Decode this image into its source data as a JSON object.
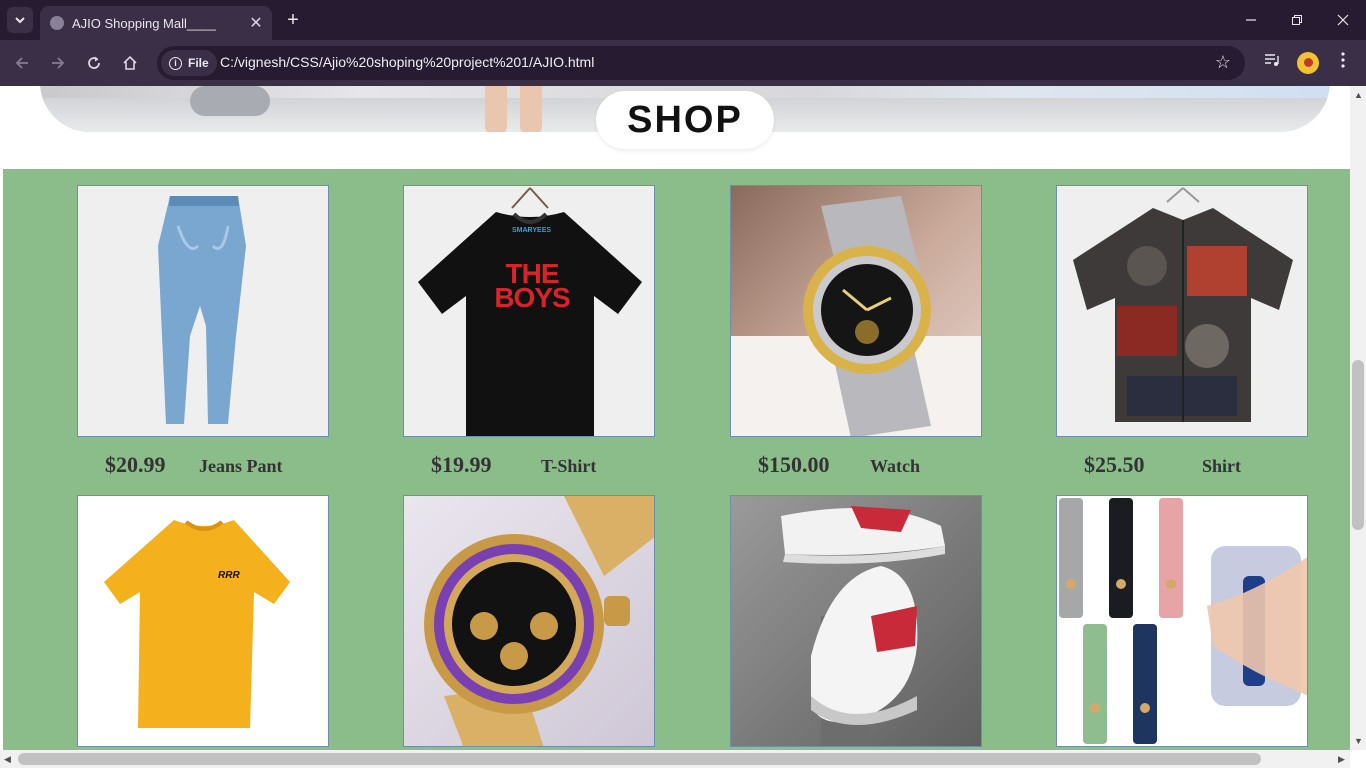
{
  "browser": {
    "tab_title": "AJIO Shopping Mall____",
    "address_chip": "File",
    "url": "C:/vignesh/CSS/Ajio%20shoping%20project%201/AJIO.html"
  },
  "banner": {
    "button_label": "SHOP"
  },
  "products": [
    {
      "price": "$20.99",
      "name": "Jeans Pant",
      "image": "jeans-image"
    },
    {
      "price": "$19.99",
      "name": "T-Shirt",
      "image": "black-tshirt-image"
    },
    {
      "price": "$150.00",
      "name": "Watch",
      "image": "watch-image"
    },
    {
      "price": "$25.50",
      "name": "Shirt",
      "image": "shirt-image"
    },
    {
      "price": "",
      "name": "",
      "image": "yellow-tshirt-image"
    },
    {
      "price": "",
      "name": "",
      "image": "gold-watch-image"
    },
    {
      "price": "",
      "name": "",
      "image": "sneakers-image"
    },
    {
      "price": "",
      "name": "",
      "image": "phone-grip-image"
    }
  ],
  "images_text": {
    "tshirt_brand": "SMARYEES",
    "tshirt_print": "THE BOYS",
    "yellow_tshirt_print": "RRR"
  },
  "colors": {
    "section_bg": "#8bbd8b",
    "browser_frame": "#261b30",
    "toolbar": "#3b2f47"
  }
}
